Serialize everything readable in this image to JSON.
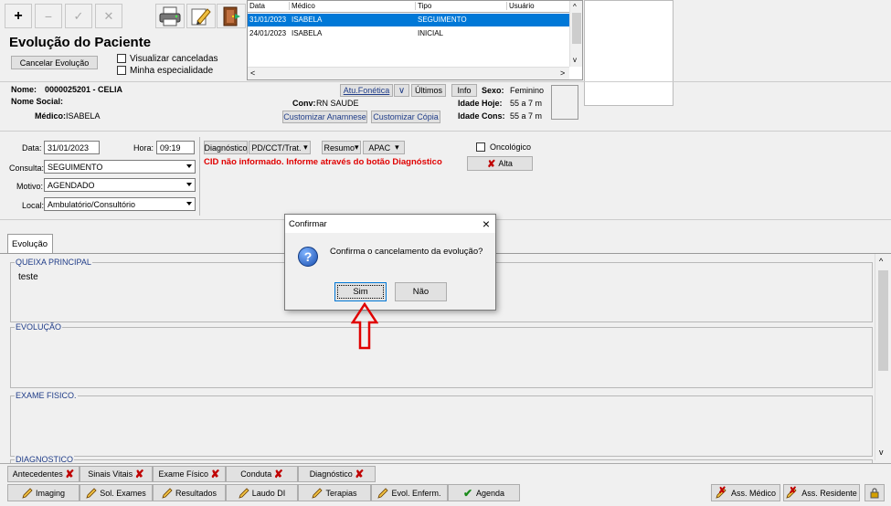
{
  "header": {
    "title": "Evolução do Paciente",
    "cancel_button": "Cancelar Evolução",
    "chk_canceladas": "Visualizar canceladas",
    "chk_especialidade": "Minha especialidade"
  },
  "grid": {
    "columns": [
      "Data",
      "Médico",
      "Tipo",
      "Usuário"
    ],
    "rows": [
      {
        "data": "31/01/2023",
        "medico": "ISABELA",
        "tipo": "SEGUIMENTO",
        "usuario": ""
      },
      {
        "data": "24/01/2023",
        "medico": "ISABELA",
        "tipo": "INICIAL",
        "usuario": ""
      }
    ]
  },
  "patient": {
    "nome_label": "Nome:",
    "nome_value": "0000025201 - CELIA",
    "nome_social_label": "Nome Social:",
    "medico_label": "Médico:",
    "medico_value": "ISABELA",
    "conv_label": "Conv:",
    "conv_value": "RN SAUDE",
    "atu_fonetica": "Atu.Fonética",
    "ultimos": "Últimos",
    "info": "Info",
    "customizar_anamnese": "Customizar Anamnese",
    "customizar_copia": "Customizar Cópia",
    "sexo_label": "Sexo:",
    "sexo_value": "Feminino",
    "idade_hoje_label": "Idade Hoje:",
    "idade_hoje_value": "55 a 7 m",
    "idade_cons_label": "Idade Cons:",
    "idade_cons_value": "55 a 7 m"
  },
  "form": {
    "data_label": "Data:",
    "data_value": "31/01/2023",
    "hora_label": "Hora:",
    "hora_value": "09:19",
    "consulta_label": "Consulta:",
    "consulta_value": "SEGUIMENTO",
    "motivo_label": "Motivo:",
    "motivo_value": "AGENDADO",
    "local_label": "Local:",
    "local_value": "Ambulatório/Consultório",
    "diagnostico_btn": "Diagnóstico",
    "pd_btn": "PD/CCT/Trat.",
    "resumo_btn": "Resumo",
    "apac_btn": "APAC",
    "cid_warning": "CID não informado. Informe através do botão Diagnóstico",
    "oncologico": "Oncológico",
    "alta": "Alta"
  },
  "tabs": {
    "evolucao": "Evolução"
  },
  "sections": {
    "queixa": "QUEIXA PRINCIPAL",
    "queixa_text": "teste",
    "evolucao": "EVOLUÇÃO",
    "exame": "EXAME FISICO.",
    "diagnostico": "DIAGNOSTICO"
  },
  "dialog": {
    "title": "Confirmar",
    "message": "Confirma o cancelamento da evolução?",
    "yes": "Sim",
    "no": "Não",
    "close": "×"
  },
  "bottom_row1": [
    "Antecedentes",
    "Sinais Vitais",
    "Exame Físico",
    "Conduta",
    "Diagnóstico"
  ],
  "bottom_row2": [
    "Imaging",
    "Sol. Exames",
    "Resultados",
    "Laudo DI",
    "Terapias",
    "Evol. Enferm.",
    "Agenda"
  ],
  "bottom_right": [
    "Ass. Médico",
    "Ass. Residente"
  ],
  "colors": {
    "selected_row": "#0078d7",
    "warning": "#e00000",
    "legend": "#1f3c88",
    "annotation_arrow": "#e00000"
  }
}
